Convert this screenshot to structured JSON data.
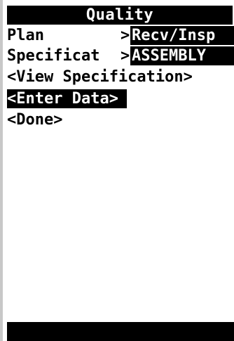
{
  "screen": {
    "title": "Quality"
  },
  "fields": [
    {
      "label": "Plan",
      "arrow": ">",
      "value": "Recv/Insp"
    },
    {
      "label": "Specificat",
      "arrow": ">",
      "value": "ASSEMBLY"
    }
  ],
  "menu": [
    {
      "label": "<View Specification>"
    },
    {
      "label": "<Enter Data>",
      "selected": true
    },
    {
      "label": "<Done>"
    }
  ],
  "colors": {
    "background": "#ffffff",
    "inverse": "#000000",
    "text": "#000000"
  }
}
